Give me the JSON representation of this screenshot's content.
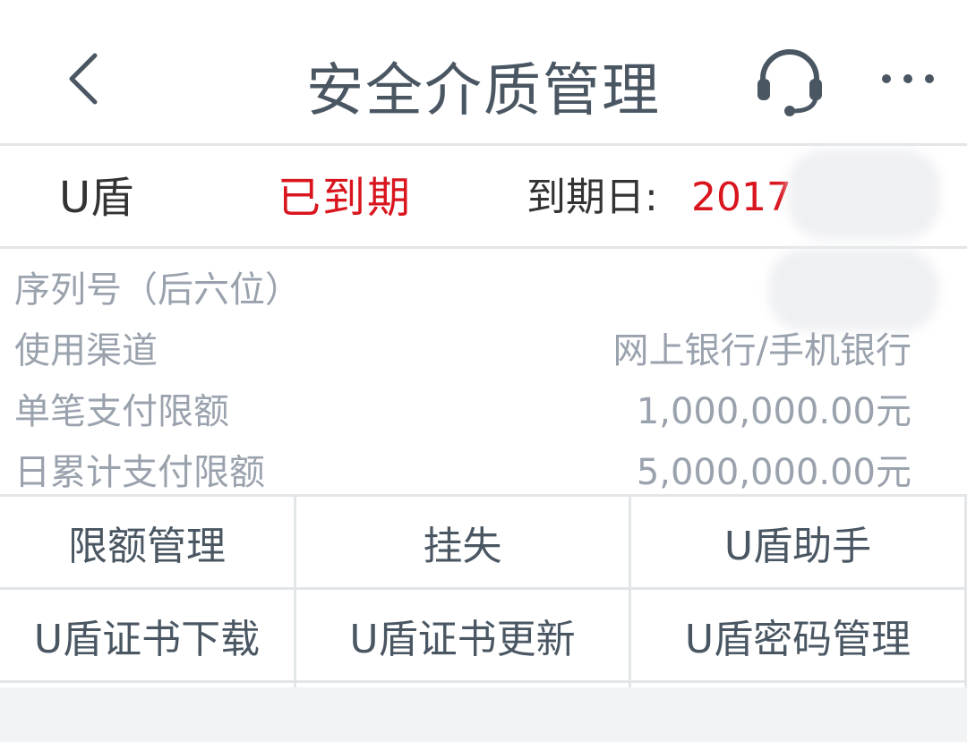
{
  "header": {
    "title": "安全介质管理",
    "back_icon": "chevron-left-icon",
    "support_icon": "headset-icon",
    "more_icon": "more-horizontal-icon"
  },
  "medium": {
    "type": "U盾",
    "status": "已到期",
    "expire_label": "到期日:",
    "expire_value": "2017"
  },
  "details": [
    {
      "label": "序列号（后六位）",
      "value": ""
    },
    {
      "label": "使用渠道",
      "value": "网上银行/手机银行"
    },
    {
      "label": "单笔支付限额",
      "value": "1,000,000.00元"
    },
    {
      "label": "日累计支付限额",
      "value": "5,000,000.00元"
    }
  ],
  "actions": [
    {
      "label": "限额管理"
    },
    {
      "label": "挂失"
    },
    {
      "label": "U盾助手"
    },
    {
      "label": "U盾证书下载"
    },
    {
      "label": "U盾证书更新"
    },
    {
      "label": "U盾密码管理"
    }
  ],
  "colors": {
    "text": "#4a5763",
    "muted": "#9aa2ad",
    "alert": "#d9151e",
    "divider": "#e3e6e9",
    "background": "#f2f3f5"
  }
}
